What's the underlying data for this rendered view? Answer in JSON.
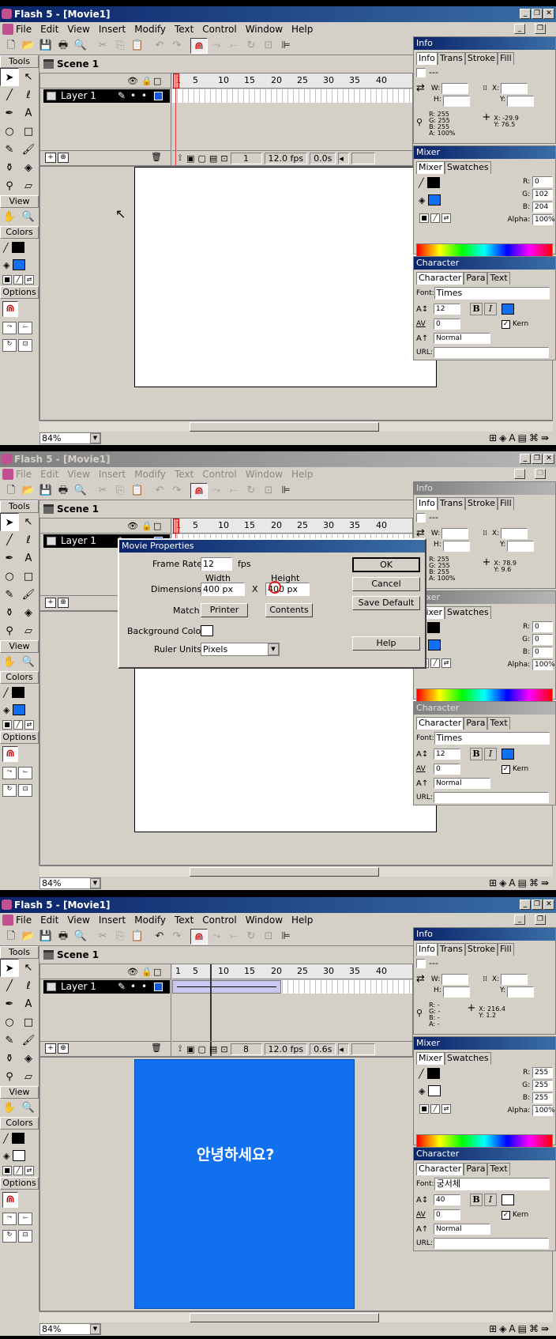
{
  "window": {
    "title": "Flash 5 - [Movie1]",
    "min": "_",
    "restore": "❐",
    "close": "✕"
  },
  "menu": [
    "File",
    "Edit",
    "View",
    "Insert",
    "Modify",
    "Text",
    "Control",
    "Window",
    "Help"
  ],
  "tools": {
    "header": "Tools",
    "view": "View",
    "colors": "Colors",
    "options": "Options"
  },
  "scene": "Scene 1",
  "layer": "Layer 1",
  "ruler_ticks": [
    "1",
    "5",
    "10",
    "15",
    "20",
    "25",
    "30",
    "35",
    "40"
  ],
  "frames": [
    {
      "frame": "1",
      "fps": "12.0 fps",
      "time": "0.0s",
      "zoom": "84%"
    },
    {
      "zoom": "84%"
    },
    {
      "frame": "8",
      "fps": "12.0 fps",
      "time": "0.6s",
      "zoom": "84%"
    }
  ],
  "panels": {
    "info": {
      "title": "Info",
      "tabs": [
        "Info",
        "Trans",
        "Stroke",
        "Fill"
      ],
      "dash": "---",
      "w": "W:",
      "h": "H:",
      "x": "X:",
      "y": "Y:"
    },
    "mixer": {
      "title": "Mixer",
      "tabs": [
        "Mixer",
        "Swatches"
      ],
      "r": "R:",
      "g": "G:",
      "b": "B:",
      "alpha": "Alpha:",
      "alpha_val": "100%"
    },
    "character": {
      "title": "Character",
      "tabs": [
        "Character",
        "Para",
        "Text"
      ],
      "font_label": "Font:",
      "size": "12",
      "tracking": "0",
      "baseline": "Normal",
      "bold": "B",
      "italic": "I",
      "kern": "Kern",
      "url": "URL:"
    }
  },
  "info_values": [
    {
      "r": "R: 255",
      "g": "G: 255",
      "b": "B: 255",
      "a": "A: 100%",
      "x": "X: -29.9",
      "y": "Y: 76.5"
    },
    {
      "r": "R: 255",
      "g": "G: 255",
      "b": "B: 255",
      "a": "A: 100%",
      "x": "X: 78.9",
      "y": "Y: 9.6"
    },
    {
      "r": "R: -",
      "g": "G: -",
      "b": "B: -",
      "a": "A: -",
      "x": "X: 216.4",
      "y": "Y: 1.2"
    }
  ],
  "mixer_values": [
    {
      "r": "0",
      "g": "102",
      "b": "204"
    },
    {
      "r": "0",
      "g": "0",
      "b": "0"
    },
    {
      "r": "255",
      "g": "255",
      "b": "255"
    }
  ],
  "fonts": [
    "Times",
    "Times",
    "궁서체"
  ],
  "font_sizes": [
    "12",
    "12",
    "40"
  ],
  "dialog": {
    "title": "Movie Properties",
    "frame_rate_label": "Frame Rate:",
    "frame_rate": "12",
    "fps": "fps",
    "width_label": "Width",
    "height_label": "Height",
    "dimensions_label": "Dimensions:",
    "width": "400 px",
    "x": "X",
    "height": "400 px",
    "match_label": "Match:",
    "printer": "Printer",
    "contents": "Contents",
    "bg_label": "Background Color:",
    "ruler_label": "Ruler Units:",
    "ruler": "Pixels",
    "ok": "OK",
    "cancel": "Cancel",
    "save_default": "Save Default",
    "help": "Help"
  },
  "stage_text": "안녕하세요?",
  "colors": {
    "accent": "#0a246a",
    "stage_blue": "#1070f0",
    "stroke": "#000000",
    "fill_blue": "#0066cc"
  }
}
